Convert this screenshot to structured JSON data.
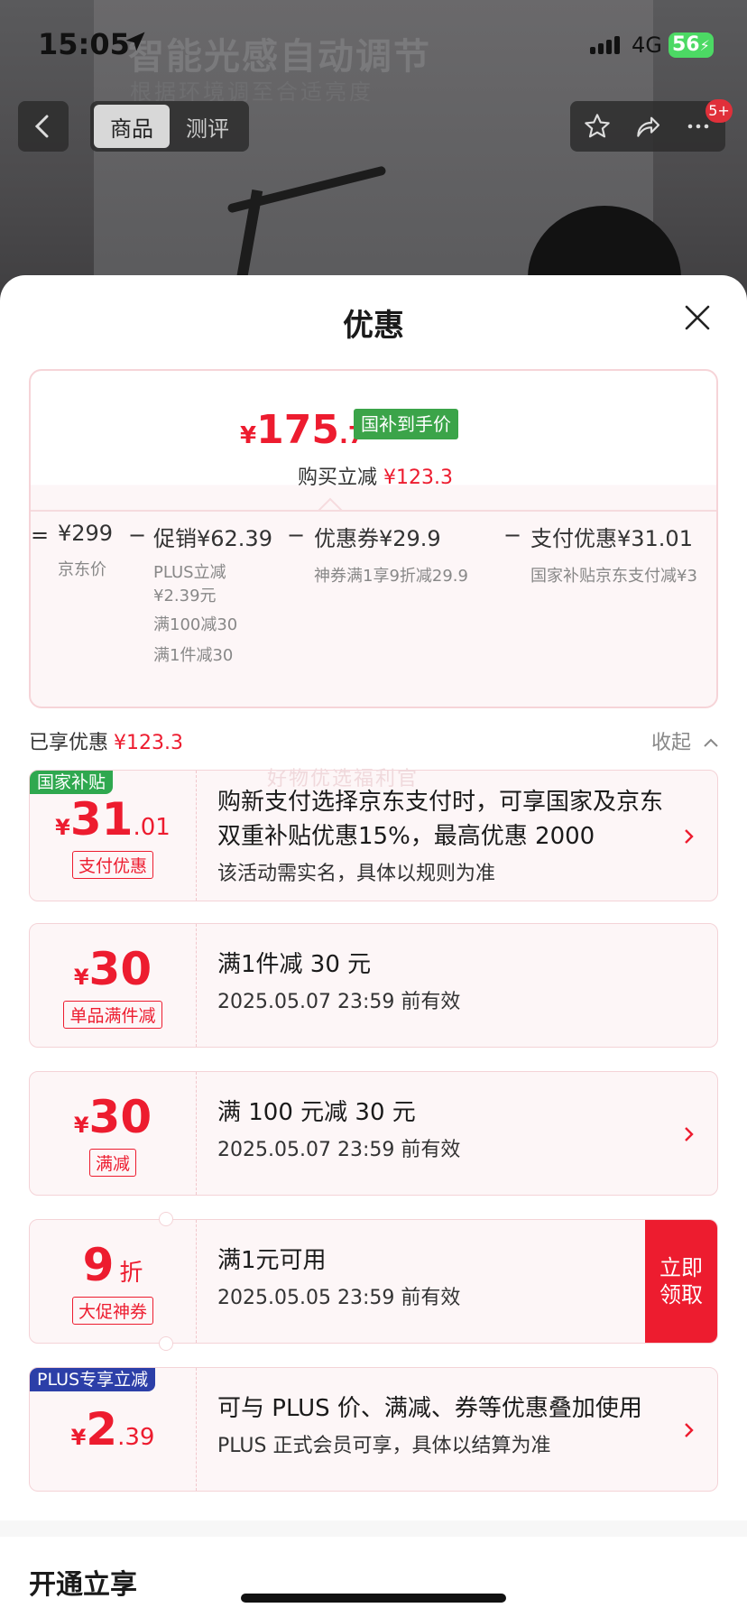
{
  "status": {
    "time": "15:05",
    "network": "4G",
    "battery": "56"
  },
  "background": {
    "title": "智能光感自动调节",
    "subtitle": "根据环境调至合适亮度"
  },
  "nav": {
    "tabs": [
      "商品",
      "测评"
    ],
    "badge": "5+"
  },
  "sheet": {
    "title": "优惠"
  },
  "price": {
    "currency": "¥",
    "integer": "175",
    "decimal": ".7",
    "tag": "国补到手价",
    "reduce_label": "购买立减",
    "reduce_value": "¥123.3"
  },
  "breakdown": [
    {
      "op": "=",
      "value": "¥299",
      "labels": [
        "京东价"
      ]
    },
    {
      "op": "−",
      "value": "促销¥62.39",
      "labels": [
        "PLUS立减",
        "¥2.39元",
        "满100减30",
        "满1件减30"
      ]
    },
    {
      "op": "−",
      "value": "优惠券¥29.9",
      "labels": [
        "神券满1享9折减29.9"
      ]
    },
    {
      "op": "−",
      "value": "支付优惠¥31.01",
      "labels": [
        "国家补贴京东支付减¥3"
      ]
    }
  ],
  "enjoyed": {
    "label": "已享优惠",
    "value": "¥123.3",
    "collapse": "收起"
  },
  "watermark": "好物优选福利官",
  "coupons": [
    {
      "corner": "国家补贴",
      "corner_color": "#2fa84f",
      "currency": "¥",
      "big": "31",
      "dec": ".01",
      "type": "支付优惠",
      "line1": "购新支付选择京东支付时，可享国家及京东双重补贴优惠15%，最高优惠 2000",
      "line2": "该活动需实名，具体以规则为准",
      "chevron": true
    },
    {
      "corner": "",
      "currency": "¥",
      "big": "30",
      "dec": "",
      "type": "单品满件减",
      "line1": "满1件减 30 元",
      "line2": "2025.05.07 23:59 前有效",
      "chevron": false
    },
    {
      "corner": "",
      "currency": "¥",
      "big": "30",
      "dec": "",
      "type": "满减",
      "line1": "满 100 元减 30 元",
      "line2": "2025.05.07 23:59 前有效",
      "chevron": true
    },
    {
      "corner": "",
      "currency": "",
      "big": "9",
      "dec": "折",
      "type": "大促神券",
      "line1": "满1元可用",
      "line2": "2025.05.05 23:59 前有效",
      "button": "立即领取"
    },
    {
      "corner": "PLUS专享立减",
      "corner_color": "#2c3fa8",
      "currency": "¥",
      "big": "2",
      "dec": ".39",
      "type": "",
      "line1": "可与 PLUS 价、满减、券等优惠叠加使用",
      "line2": "PLUS 正式会员可享，具体以结算为准",
      "chevron": true
    }
  ],
  "footer": {
    "title": "开通立享"
  }
}
